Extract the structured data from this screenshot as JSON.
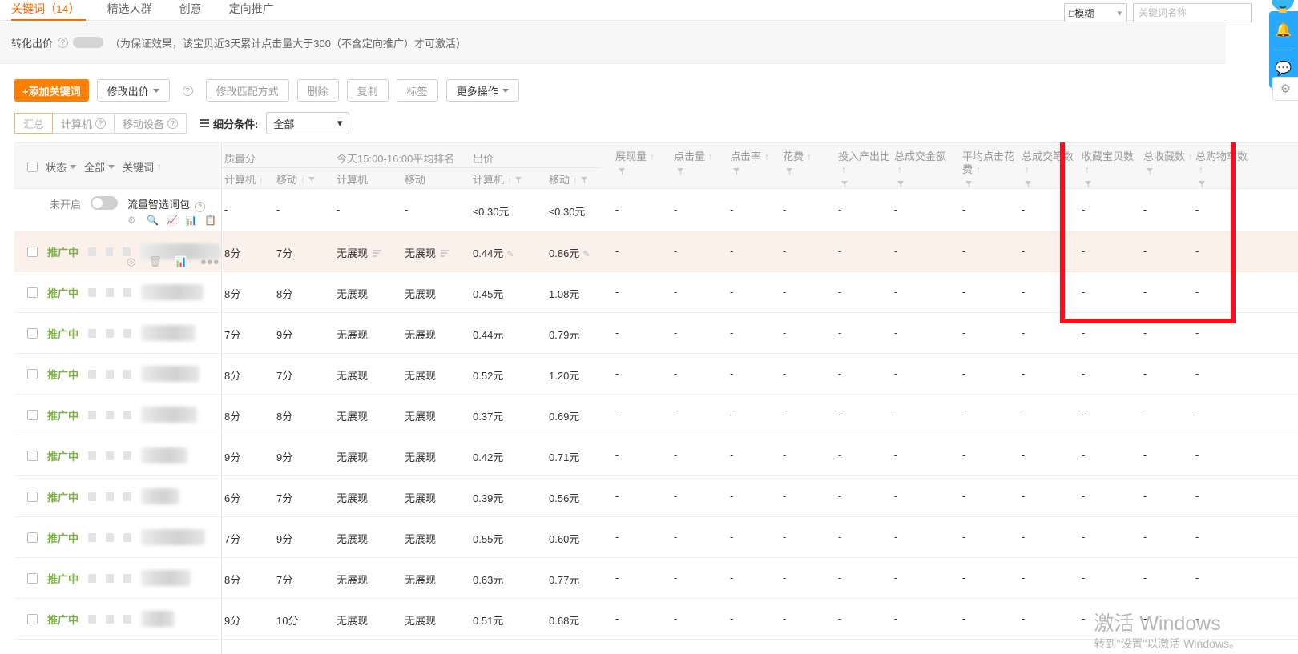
{
  "tabs": [
    {
      "label": "关键词（14）",
      "active": true
    },
    {
      "label": "精选人群",
      "active": false
    },
    {
      "label": "创意",
      "active": false
    },
    {
      "label": "定向推广",
      "active": false
    }
  ],
  "conversion_bar": {
    "label": "转化出价",
    "help_icon": "question-icon",
    "hint": "（为保证效果，该宝贝近3天累计点击量大于300（不含定向推广）才可激活）"
  },
  "search": {
    "match_mode": "□模糊",
    "keyword_placeholder": "关键词名称",
    "keyword_value": ""
  },
  "toolbar": {
    "add_keyword": "+添加关键词",
    "modify_bid": "修改出价",
    "help_icon": "question-icon",
    "modify_match": "修改匹配方式",
    "delete": "删除",
    "copy": "复制",
    "tag": "标签",
    "more": "更多操作"
  },
  "segment": {
    "options": [
      "汇总",
      "计算机",
      "移动设备"
    ],
    "active": "汇总",
    "fine_label": "细分条件:",
    "fine_value": "全部"
  },
  "table": {
    "left_header": {
      "status": "状态",
      "all": "全部",
      "keyword": "关键词"
    },
    "groups": [
      {
        "title": "质量分",
        "subs": [
          "计算机",
          "移动"
        ]
      },
      {
        "title": "今天15:00-16:00平均排名",
        "subs": [
          "计算机",
          "移动"
        ]
      },
      {
        "title": "出价",
        "subs": [
          "计算机",
          "移动"
        ]
      }
    ],
    "metrics": [
      "展现量",
      "点击量",
      "点击率",
      "花费",
      "投入产出比",
      "总成交金额",
      "平均点击花费",
      "总成交笔数",
      "收藏宝贝数",
      "总收藏数",
      "总购物车数"
    ],
    "rows": [
      {
        "type": "package",
        "status": "未开启",
        "name": "流量智选词包",
        "toggle": "off",
        "quality_pc": "-",
        "quality_mobile": "-",
        "rank_pc": "-",
        "rank_mobile": "-",
        "bid_pc": "≤0.30元",
        "bid_mobile": "≤0.30元",
        "metrics": [
          "-",
          "-",
          "-",
          "-",
          "-",
          "-",
          "-",
          "-",
          "-",
          "-",
          "-"
        ]
      },
      {
        "type": "keyword",
        "status": "推广中",
        "highlighted": true,
        "quality_pc": "8分",
        "quality_mobile": "7分",
        "rank_pc": "无展现",
        "rank_mobile": "无展现",
        "rank_has_icon": true,
        "bid_pc": "0.44元",
        "bid_mobile": "0.86元",
        "bid_editable": true,
        "metrics": [
          "-",
          "-",
          "-",
          "-",
          "-",
          "-",
          "-",
          "-",
          "-",
          "-",
          "-"
        ]
      },
      {
        "type": "keyword",
        "status": "推广中",
        "quality_pc": "8分",
        "quality_mobile": "8分",
        "rank_pc": "无展现",
        "rank_mobile": "无展现",
        "bid_pc": "0.45元",
        "bid_mobile": "1.08元",
        "metrics": [
          "-",
          "-",
          "-",
          "-",
          "-",
          "-",
          "-",
          "-",
          "-",
          "-",
          "-"
        ]
      },
      {
        "type": "keyword",
        "status": "推广中",
        "quality_pc": "7分",
        "quality_mobile": "9分",
        "rank_pc": "无展现",
        "rank_mobile": "无展现",
        "bid_pc": "0.44元",
        "bid_mobile": "0.79元",
        "metrics": [
          "-",
          "-",
          "-",
          "-",
          "-",
          "-",
          "-",
          "-",
          "-",
          "-",
          "-"
        ]
      },
      {
        "type": "keyword",
        "status": "推广中",
        "quality_pc": "8分",
        "quality_mobile": "7分",
        "rank_pc": "无展现",
        "rank_mobile": "无展现",
        "bid_pc": "0.52元",
        "bid_mobile": "1.20元",
        "metrics": [
          "-",
          "-",
          "-",
          "-",
          "-",
          "-",
          "-",
          "-",
          "-",
          "-",
          "-"
        ]
      },
      {
        "type": "keyword",
        "status": "推广中",
        "quality_pc": "8分",
        "quality_mobile": "8分",
        "rank_pc": "无展现",
        "rank_mobile": "无展现",
        "bid_pc": "0.37元",
        "bid_mobile": "0.69元",
        "metrics": [
          "-",
          "-",
          "-",
          "-",
          "-",
          "-",
          "-",
          "-",
          "-",
          "-",
          "-"
        ]
      },
      {
        "type": "keyword",
        "status": "推广中",
        "quality_pc": "9分",
        "quality_mobile": "9分",
        "rank_pc": "无展现",
        "rank_mobile": "无展现",
        "bid_pc": "0.42元",
        "bid_mobile": "0.71元",
        "metrics": [
          "-",
          "-",
          "-",
          "-",
          "-",
          "-",
          "-",
          "-",
          "-",
          "-",
          "-"
        ]
      },
      {
        "type": "keyword",
        "status": "推广中",
        "quality_pc": "6分",
        "quality_mobile": "7分",
        "rank_pc": "无展现",
        "rank_mobile": "无展现",
        "bid_pc": "0.39元",
        "bid_mobile": "0.56元",
        "metrics": [
          "-",
          "-",
          "-",
          "-",
          "-",
          "-",
          "-",
          "-",
          "-",
          "-",
          "-"
        ]
      },
      {
        "type": "keyword",
        "status": "推广中",
        "quality_pc": "7分",
        "quality_mobile": "9分",
        "rank_pc": "无展现",
        "rank_mobile": "无展现",
        "bid_pc": "0.55元",
        "bid_mobile": "0.60元",
        "metrics": [
          "-",
          "-",
          "-",
          "-",
          "-",
          "-",
          "-",
          "-",
          "-",
          "-",
          "-"
        ]
      },
      {
        "type": "keyword",
        "status": "推广中",
        "quality_pc": "8分",
        "quality_mobile": "7分",
        "rank_pc": "无展现",
        "rank_mobile": "无展现",
        "bid_pc": "0.63元",
        "bid_mobile": "0.77元",
        "metrics": [
          "-",
          "-",
          "-",
          "-",
          "-",
          "-",
          "-",
          "-",
          "-",
          "-",
          "-"
        ]
      },
      {
        "type": "keyword",
        "status": "推广中",
        "quality_pc": "9分",
        "quality_mobile": "10分",
        "rank_pc": "无展现",
        "rank_mobile": "无展现",
        "bid_pc": "0.51元",
        "bid_mobile": "0.68元",
        "metrics": [
          "-",
          "-",
          "-",
          "-",
          "-",
          "-",
          "-",
          "-",
          "-",
          "-",
          "-"
        ]
      }
    ]
  },
  "annotation": {
    "type": "red-rectangle",
    "color": "#fb0d1b",
    "covers": [
      "收藏宝贝数",
      "总收藏数",
      "总购物车数"
    ]
  },
  "float_widget": {
    "bell_icon": "bell-icon",
    "chat_icon": "chat-icon",
    "gear_icon": "gear-icon",
    "accent": "#29a8ff"
  },
  "watermark": {
    "line1": "激活 Windows",
    "line2": "转到\"设置\"以激活 Windows。"
  }
}
